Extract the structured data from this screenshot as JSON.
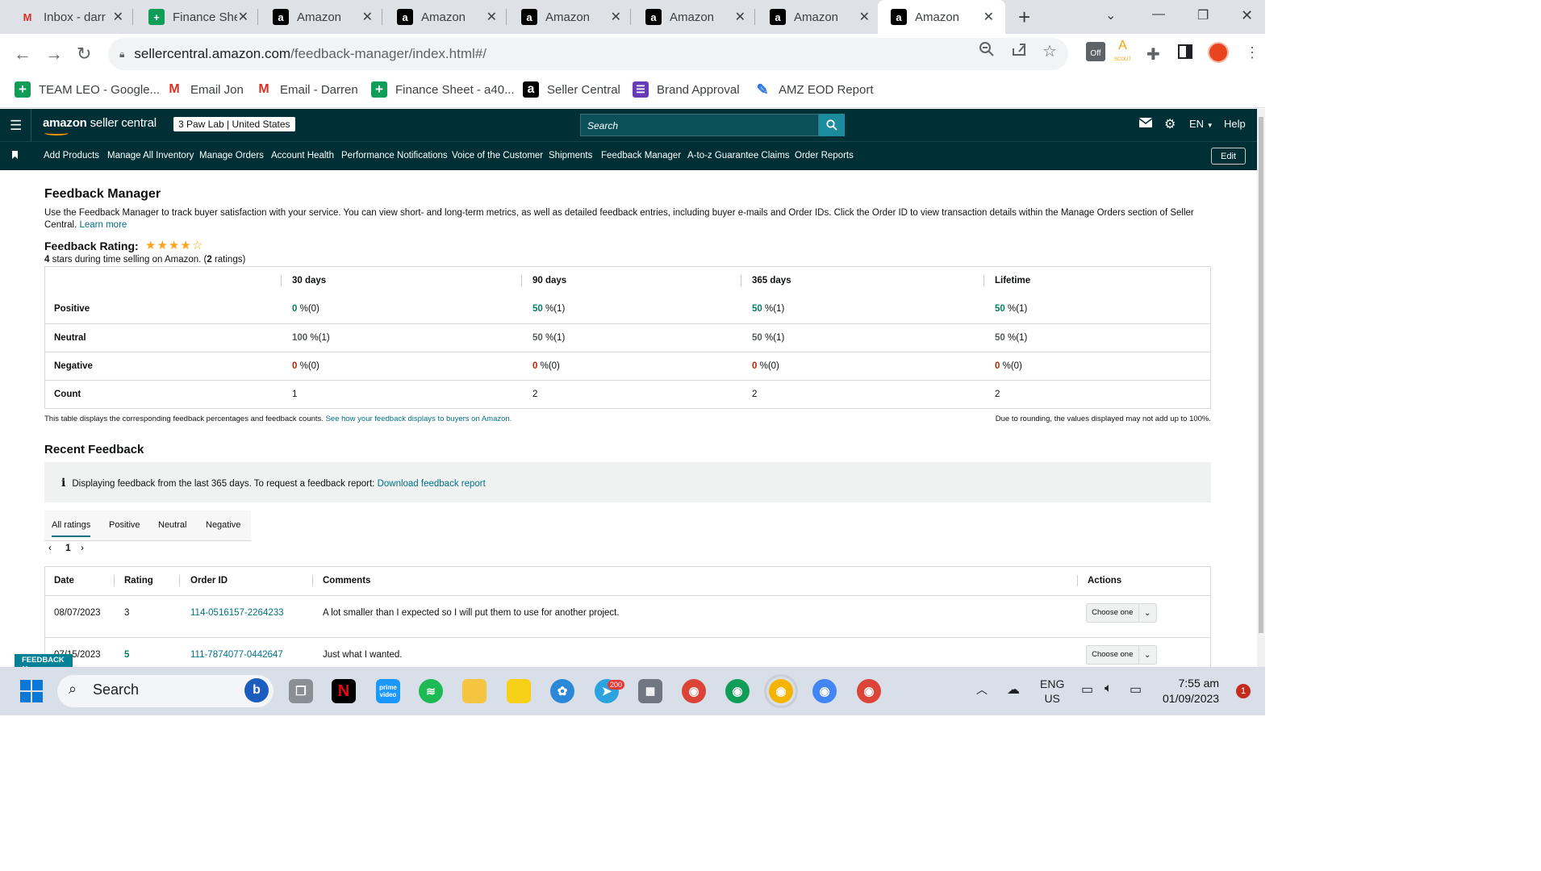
{
  "browser": {
    "tabs": [
      {
        "label": "Inbox - darr",
        "icon": "gmail-icon"
      },
      {
        "label": "Finance She",
        "icon": "sheets-icon"
      },
      {
        "label": "Amazon",
        "icon": "amazon-icon"
      },
      {
        "label": "Amazon",
        "icon": "amazon-icon"
      },
      {
        "label": "Amazon",
        "icon": "amazon-icon"
      },
      {
        "label": "Amazon",
        "icon": "amazon-icon"
      },
      {
        "label": "Amazon",
        "icon": "amazon-icon"
      },
      {
        "label": "Amazon",
        "icon": "amazon-icon",
        "active": true
      }
    ],
    "url_host": "sellercentral.amazon.com",
    "url_path": "/feedback-manager/index.html#/",
    "extension_badge": "Off",
    "extension_label": "SCOUT",
    "bookmarks": [
      {
        "label": "TEAM LEO - Google...",
        "icon": "sheets-icon"
      },
      {
        "label": "Email Jon",
        "icon": "gmail-icon"
      },
      {
        "label": "Email - Darren",
        "icon": "gmail-icon"
      },
      {
        "label": "Finance Sheet - a40...",
        "icon": "sheets-icon"
      },
      {
        "label": "Seller Central",
        "icon": "amazon-icon"
      },
      {
        "label": "Brand Approval",
        "icon": "forms-icon"
      },
      {
        "label": "AMZ EOD Report",
        "icon": "report-icon"
      }
    ]
  },
  "header": {
    "logo_bold": "amazon",
    "logo_rest": " seller central",
    "store_name": "3 Paw Lab",
    "marketplace": "United States",
    "search_placeholder": "Search",
    "language": "EN",
    "help": "Help"
  },
  "nav": {
    "items": [
      "Add Products",
      "Manage All Inventory",
      "Manage Orders",
      "Account Health",
      "Performance Notifications",
      "Voice of the Customer",
      "Shipments",
      "Feedback Manager",
      "A-to-z Guarantee Claims",
      "Order Reports"
    ],
    "edit": "Edit"
  },
  "page": {
    "title": "Feedback Manager",
    "description": "Use the Feedback Manager to track buyer satisfaction with your service. You can view short- and long-term metrics, as well as detailed feedback entries, including buyer e-mails and Order IDs. Click the Order ID to view transaction details within the Manage Orders section of Seller Central.",
    "learn_more": "Learn more",
    "rating_title": "Feedback Rating:",
    "rating_stars": 4,
    "rating_max": 5,
    "rating_sub_prefix": "4",
    "rating_sub_mid": " stars during time selling on Amazon. (",
    "rating_sub_count": "2",
    "rating_sub_suffix": " ratings)"
  },
  "metrics": {
    "columns": [
      "30 days",
      "90 days",
      "365 days",
      "Lifetime"
    ],
    "rows": [
      {
        "label": "Positive",
        "type": "pos",
        "cells": [
          [
            "0",
            " %(0)"
          ],
          [
            "50",
            " %(1)"
          ],
          [
            "50",
            " %(1)"
          ],
          [
            "50",
            " %(1)"
          ]
        ]
      },
      {
        "label": "Neutral",
        "type": "neu",
        "cells": [
          [
            "100",
            " %(1)"
          ],
          [
            "50",
            " %(1)"
          ],
          [
            "50",
            " %(1)"
          ],
          [
            "50",
            " %(1)"
          ]
        ]
      },
      {
        "label": "Negative",
        "type": "neg",
        "cells": [
          [
            "0",
            " %(0)"
          ],
          [
            "0",
            " %(0)"
          ],
          [
            "0",
            " %(0)"
          ],
          [
            "0",
            " %(0)"
          ]
        ]
      },
      {
        "label": "Count",
        "type": "plain",
        "cells": [
          [
            "1",
            ""
          ],
          [
            "2",
            ""
          ],
          [
            "2",
            ""
          ],
          [
            "2",
            ""
          ]
        ]
      }
    ],
    "footnote_left": "This table displays the corresponding feedback percentages and feedback counts.",
    "footnote_link": "See how your feedback displays to buyers on Amazon.",
    "footnote_right": "Due to rounding, the values displayed may not add up to 100%."
  },
  "recent": {
    "title": "Recent Feedback",
    "info_text": "Displaying feedback from the last 365 days. To request a feedback report:",
    "info_link": "Download feedback report",
    "filter_tabs": [
      "All ratings",
      "Positive",
      "Neutral",
      "Negative"
    ],
    "page": "1",
    "columns": [
      "Date",
      "Rating",
      "Order ID",
      "Comments",
      "Actions"
    ],
    "rows": [
      {
        "date": "08/07/2023",
        "rating": "3",
        "rating_type": "neu",
        "order_id": "114-0516157-2264233",
        "comment": "A lot smaller than I expected so I will put them to use for another project.",
        "action": "Choose one"
      },
      {
        "date": "07/15/2023",
        "rating": "5",
        "rating_type": "pos",
        "order_id": "111-7874077-0442647",
        "comment": "Just what I wanted.",
        "action": "Choose one"
      }
    ],
    "feedback_badge": "FEEDBACK"
  },
  "taskbar": {
    "search": "Search",
    "telegram_badge": "200",
    "lang_top": "ENG",
    "lang_bottom": "US",
    "time": "7:55 am",
    "date": "01/09/2023",
    "notifications": "1"
  }
}
